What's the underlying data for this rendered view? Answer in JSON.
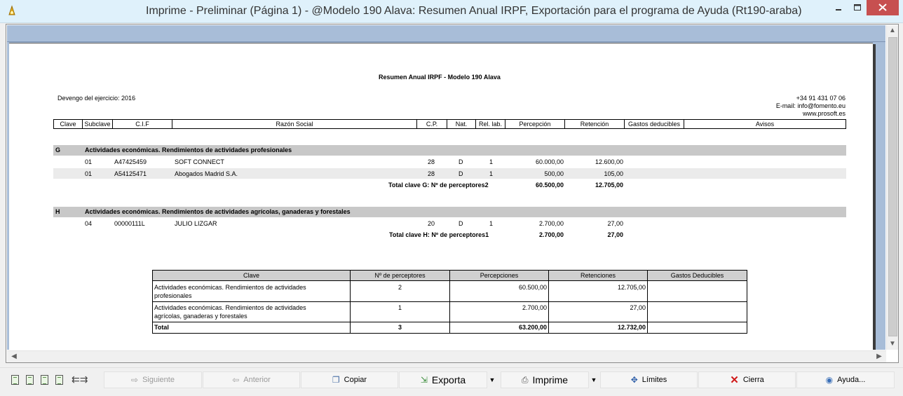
{
  "window": {
    "title": "Imprime - Preliminar (Página 1)  - @Modelo 190 Alava: Resumen Anual IRPF, Exportación para el programa de Ayuda (Rt190-araba)"
  },
  "report": {
    "title": "Resumen Anual IRPF - Modelo 190 Alava",
    "devengo": "Devengo del ejercicio: 2016",
    "contact": {
      "phone": "+34 91 431 07 06",
      "email": "E-mail: info@fomento.eu",
      "web": "www.prosoft.es"
    },
    "columns": [
      "Clave",
      "Subclave",
      "C.I.F",
      "Razón Social",
      "C.P.",
      "Nat.",
      "Rel. lab.",
      "Percepción",
      "Retención",
      "Gastos deducibles",
      "Avisos"
    ],
    "groups": [
      {
        "code": "G",
        "name": "Actividades económicas. Rendimientos de actividades profesionales",
        "rows": [
          {
            "subclave": "01",
            "cif": "A47425459",
            "razon": "SOFT CONNECT",
            "cp": "28",
            "nat": "D",
            "rel": "1",
            "percepcion": "60.000,00",
            "retencion": "12.600,00"
          },
          {
            "subclave": "01",
            "cif": "A54125471",
            "razon": "Abogados Madrid S.A.",
            "cp": "28",
            "nat": "D",
            "rel": "1",
            "percepcion": "500,00",
            "retencion": "105,00"
          }
        ],
        "total_label": "Total clave G:  Nº de perceptores2",
        "total_percepcion": "60.500,00",
        "total_retencion": "12.705,00"
      },
      {
        "code": "H",
        "name": "Actividades económicas. Rendimientos de actividades agrícolas, ganaderas y forestales",
        "rows": [
          {
            "subclave": "04",
            "cif": "00000111L",
            "razon": "JULIO LIZGAR",
            "cp": "20",
            "nat": "D",
            "rel": "1",
            "percepcion": "2.700,00",
            "retencion": "27,00"
          }
        ],
        "total_label": "Total clave H:  Nº de perceptores1",
        "total_percepcion": "2.700,00",
        "total_retencion": "27,00"
      }
    ],
    "summary": {
      "headers": [
        "Clave",
        "Nº de perceptores",
        "Percepciones",
        "Retenciones",
        "Gastos Deducibles"
      ],
      "rows": [
        {
          "clave_l1": "Actividades económicas. Rendimientos de actividades",
          "clave_l2": "profesionales",
          "n": "2",
          "percepciones": "60.500,00",
          "retenciones": "12.705,00"
        },
        {
          "clave_l1": "Actividades económicas. Rendimientos de actividades",
          "clave_l2": "agrícolas, ganaderas y forestales",
          "n": "1",
          "percepciones": "2.700,00",
          "retenciones": "27,00"
        }
      ],
      "total": {
        "label": "Total",
        "n": "3",
        "percepciones": "63.200,00",
        "retenciones": "12.732,00"
      }
    }
  },
  "toolbar": {
    "siguiente": "Siguiente",
    "anterior": "Anterior",
    "copiar": "Copiar",
    "exporta": "Exporta",
    "imprime": "Imprime",
    "limites": "Límites",
    "cierra": "Cierra",
    "ayuda": "Ayuda..."
  },
  "colors": {
    "titlebar": "#dff1fb",
    "close": "#c75050",
    "previewBg": "#a8bdd8",
    "band": "#c8c8c8"
  }
}
